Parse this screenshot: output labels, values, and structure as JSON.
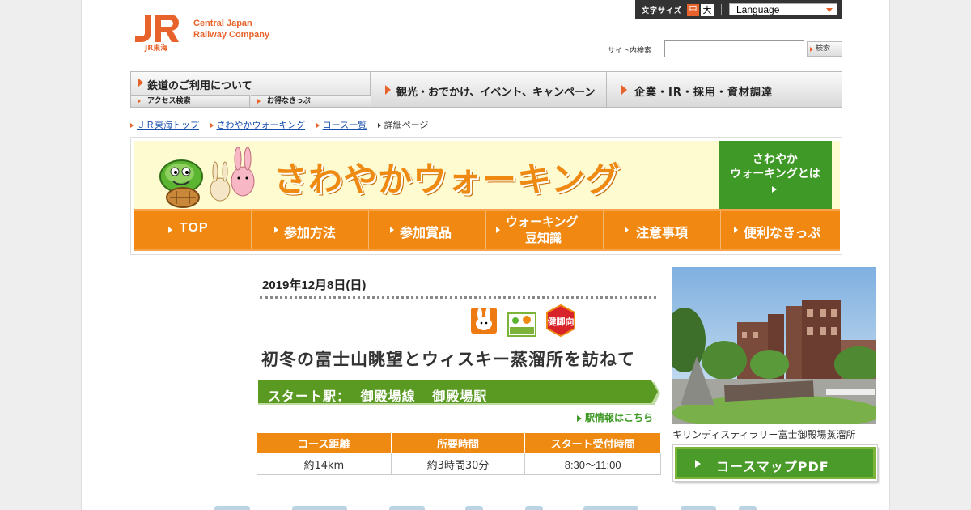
{
  "header": {
    "logo_mark": "JR",
    "logo_sub": "JR東海",
    "logo_line1": "Central Japan",
    "logo_line2": "Railway Company",
    "font_size_label": "文字サイズ",
    "font_size_mid": "中",
    "font_size_large": "大",
    "language": "Language",
    "search_label": "サイト内検索",
    "search_value": "",
    "search_button": "検索"
  },
  "global_nav": {
    "rail": "鉄道のご利用について",
    "sub_access": "アクセス検索",
    "sub_ticket": "お得なきっぷ",
    "sightseeing": "観光・おでかけ、イベント、キャンペーン",
    "corporate": "企業・IR・採用・資材調達"
  },
  "breadcrumb": [
    "ＪＲ東海トップ",
    "さわやかウォーキング",
    "コース一覧",
    "詳細ページ"
  ],
  "walking_banner": {
    "title": "さわやかウォーキング",
    "about_line1": "さわやか",
    "about_line2": "ウォーキングとは"
  },
  "local_nav": [
    "TOP",
    "参加方法",
    "参加賞品",
    "ウォーキング\n豆知識",
    "注意事項",
    "便利なきっぷ"
  ],
  "local_nav_wk1": "ウォーキング",
  "local_nav_wk2": "豆知識",
  "course": {
    "date": "2019年12月8日(日)",
    "badge_3": "健脚向",
    "title": "初冬の富士山眺望とウィスキー蒸溜所を訪ねて",
    "start_label": "スタート駅：",
    "start_line": "御殿場線",
    "start_station": "御殿場駅",
    "station_link": "駅情報はこちら",
    "table_headers": [
      "コース距離",
      "所要時間",
      "スタート受付時間"
    ],
    "table_values": [
      "約14km",
      "約3時間30分",
      "8:30～11:00"
    ],
    "photo_caption": "キリンディスティラリー富士御殿場蒸溜所",
    "map_button": "コースマップPDF"
  },
  "colors": {
    "jr_orange": "#e8632b",
    "walk_orange": "#ee8a12",
    "walk_green": "#3f9926",
    "banner_bg": "#fffbd0",
    "link_blue": "#1a4fae"
  }
}
